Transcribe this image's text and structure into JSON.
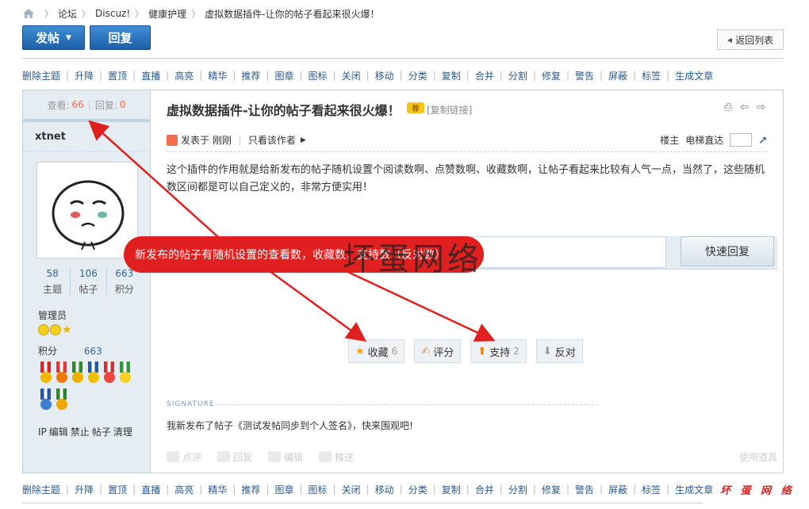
{
  "breadcrumb": {
    "items": [
      "论坛",
      "Discuz!",
      "健康护理",
      "虚拟数据插件-让你的帖子看起来很火爆！"
    ]
  },
  "toolbar": {
    "post_label": "发帖",
    "reply_label": "回复",
    "back_label": "返回列表"
  },
  "mod_actions": [
    "删除主题",
    "升降",
    "置顶",
    "直播",
    "高亮",
    "精华",
    "推荐",
    "图章",
    "图标",
    "关闭",
    "移动",
    "分类",
    "复制",
    "合并",
    "分割",
    "修复",
    "警告",
    "屏蔽",
    "标签",
    "生成文章"
  ],
  "sidebar": {
    "views_label": "查看:",
    "views": "66",
    "replies_label": "回复:",
    "replies": "0",
    "author": "xtnet",
    "counters": [
      {
        "value": "58",
        "label": "主题"
      },
      {
        "value": "106",
        "label": "帖子"
      },
      {
        "value": "663",
        "label": "积分"
      }
    ],
    "group": "管理员",
    "credits_label": "积分",
    "credits_value": "663",
    "links": [
      "IP",
      "编辑",
      "禁止",
      "帖子",
      "清理"
    ]
  },
  "post": {
    "title": "虚拟数据插件-让你的帖子看起来很火爆！",
    "badge": "荐",
    "copy_link": "[复制链接]",
    "posted_at": "发表于 刚刚",
    "author_only": "只看该作者",
    "floor": "楼主",
    "elevator": "电梯直达",
    "content": "这个插件的作用就是给新发布的帖子随机设置个阅读数啊、点赞数啊、收藏数啊，让帖子看起来比较有人气一点，当然了，这些随机数区间都是可以自己定义的，非常方便实用！",
    "quick_reply": "快速回复",
    "votes": [
      {
        "icon": "star-icon",
        "label": "收藏",
        "count": "6"
      },
      {
        "icon": "rate-icon",
        "label": "评分",
        "count": ""
      },
      {
        "icon": "support-icon",
        "label": "支持",
        "count": "2"
      },
      {
        "icon": "oppose-icon",
        "label": "反对",
        "count": ""
      }
    ],
    "signature_label": "SIGNATURE",
    "signature": "我新发布了帖子《测试发帖同步到个人签名》，快来围观吧!",
    "actions": [
      "点评",
      "回复",
      "编辑",
      "推送"
    ],
    "tools": "使用道具"
  },
  "annotation": {
    "callout": "新发布的帖子有随机设置的查看数，收藏数，支持数（反对数）",
    "watermark": "坏蛋网络",
    "corner_mark": "坏 蛋 网 络",
    "color": "#e01f1f"
  }
}
